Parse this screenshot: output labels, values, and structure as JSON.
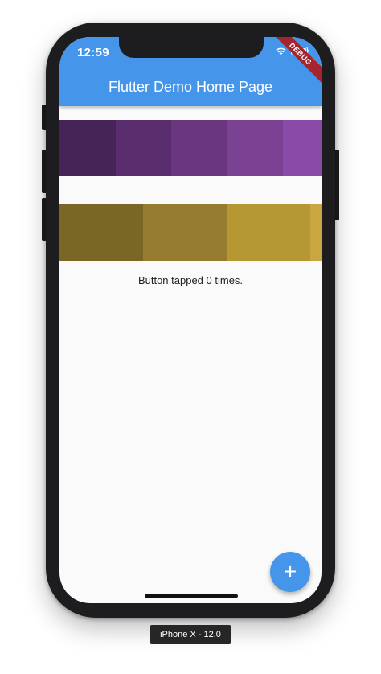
{
  "status_bar": {
    "time": "12:59",
    "icons": [
      "wifi-icon",
      "battery-icon"
    ]
  },
  "app_bar": {
    "title": "Flutter Demo Home Page",
    "color": "#4596eb"
  },
  "debug_banner": {
    "label": "DEBUG",
    "color": "#a4262c"
  },
  "rows": {
    "purple": [
      "#472457",
      "#5a2d6e",
      "#6a3680",
      "#7b4192",
      "#8a4ba8"
    ],
    "gold": [
      "#7a6625",
      "#957c2e",
      "#b59734",
      "#c9a640"
    ]
  },
  "counter": {
    "text": "Button tapped 0 times."
  },
  "fab": {
    "label": "+",
    "icon": "add-icon"
  },
  "device": {
    "label": "iPhone X - 12.0"
  }
}
